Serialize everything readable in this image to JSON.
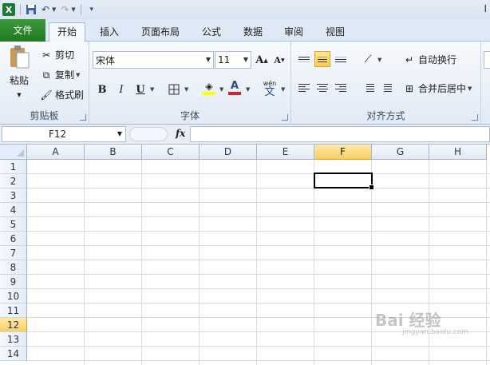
{
  "window": {
    "title_fragment": "I"
  },
  "tabs": [
    {
      "label": "文件"
    },
    {
      "label": "开始"
    },
    {
      "label": "插入"
    },
    {
      "label": "页面布局"
    },
    {
      "label": "公式"
    },
    {
      "label": "数据"
    },
    {
      "label": "审阅"
    },
    {
      "label": "视图"
    }
  ],
  "clipboard": {
    "paste_label": "粘贴",
    "cut_label": "剪切",
    "copy_label": "复制",
    "format_painter_label": "格式刷",
    "group_label": "剪贴板"
  },
  "font": {
    "font_name": "宋体",
    "font_size": "11",
    "bold": "B",
    "italic": "I",
    "underline": "U",
    "font_color_glyph": "A",
    "phonetic_glyph": "文",
    "phonetic_top": "wén",
    "group_label": "字体"
  },
  "alignment": {
    "wrap_text_label": "自动换行",
    "merge_center_label": "合并后居中",
    "group_label": "对齐方式"
  },
  "formula_bar": {
    "name_box": "F12",
    "fx_label": "fx"
  },
  "grid": {
    "columns": [
      "A",
      "B",
      "C",
      "D",
      "E",
      "F",
      "G",
      "H"
    ],
    "rows": [
      "1",
      "2",
      "3",
      "4",
      "5",
      "6",
      "7",
      "8",
      "9",
      "10",
      "11",
      "12",
      "13",
      "14"
    ],
    "selected_column": "F",
    "selected_row": "12"
  },
  "watermark": {
    "text": "Bai 经验",
    "sub": "jingyan.baidu.com"
  },
  "colors": {
    "file_tab": "#1f7a1f",
    "selection_header": "#f9cf63",
    "ribbon_bg": "#e2eaf5"
  }
}
